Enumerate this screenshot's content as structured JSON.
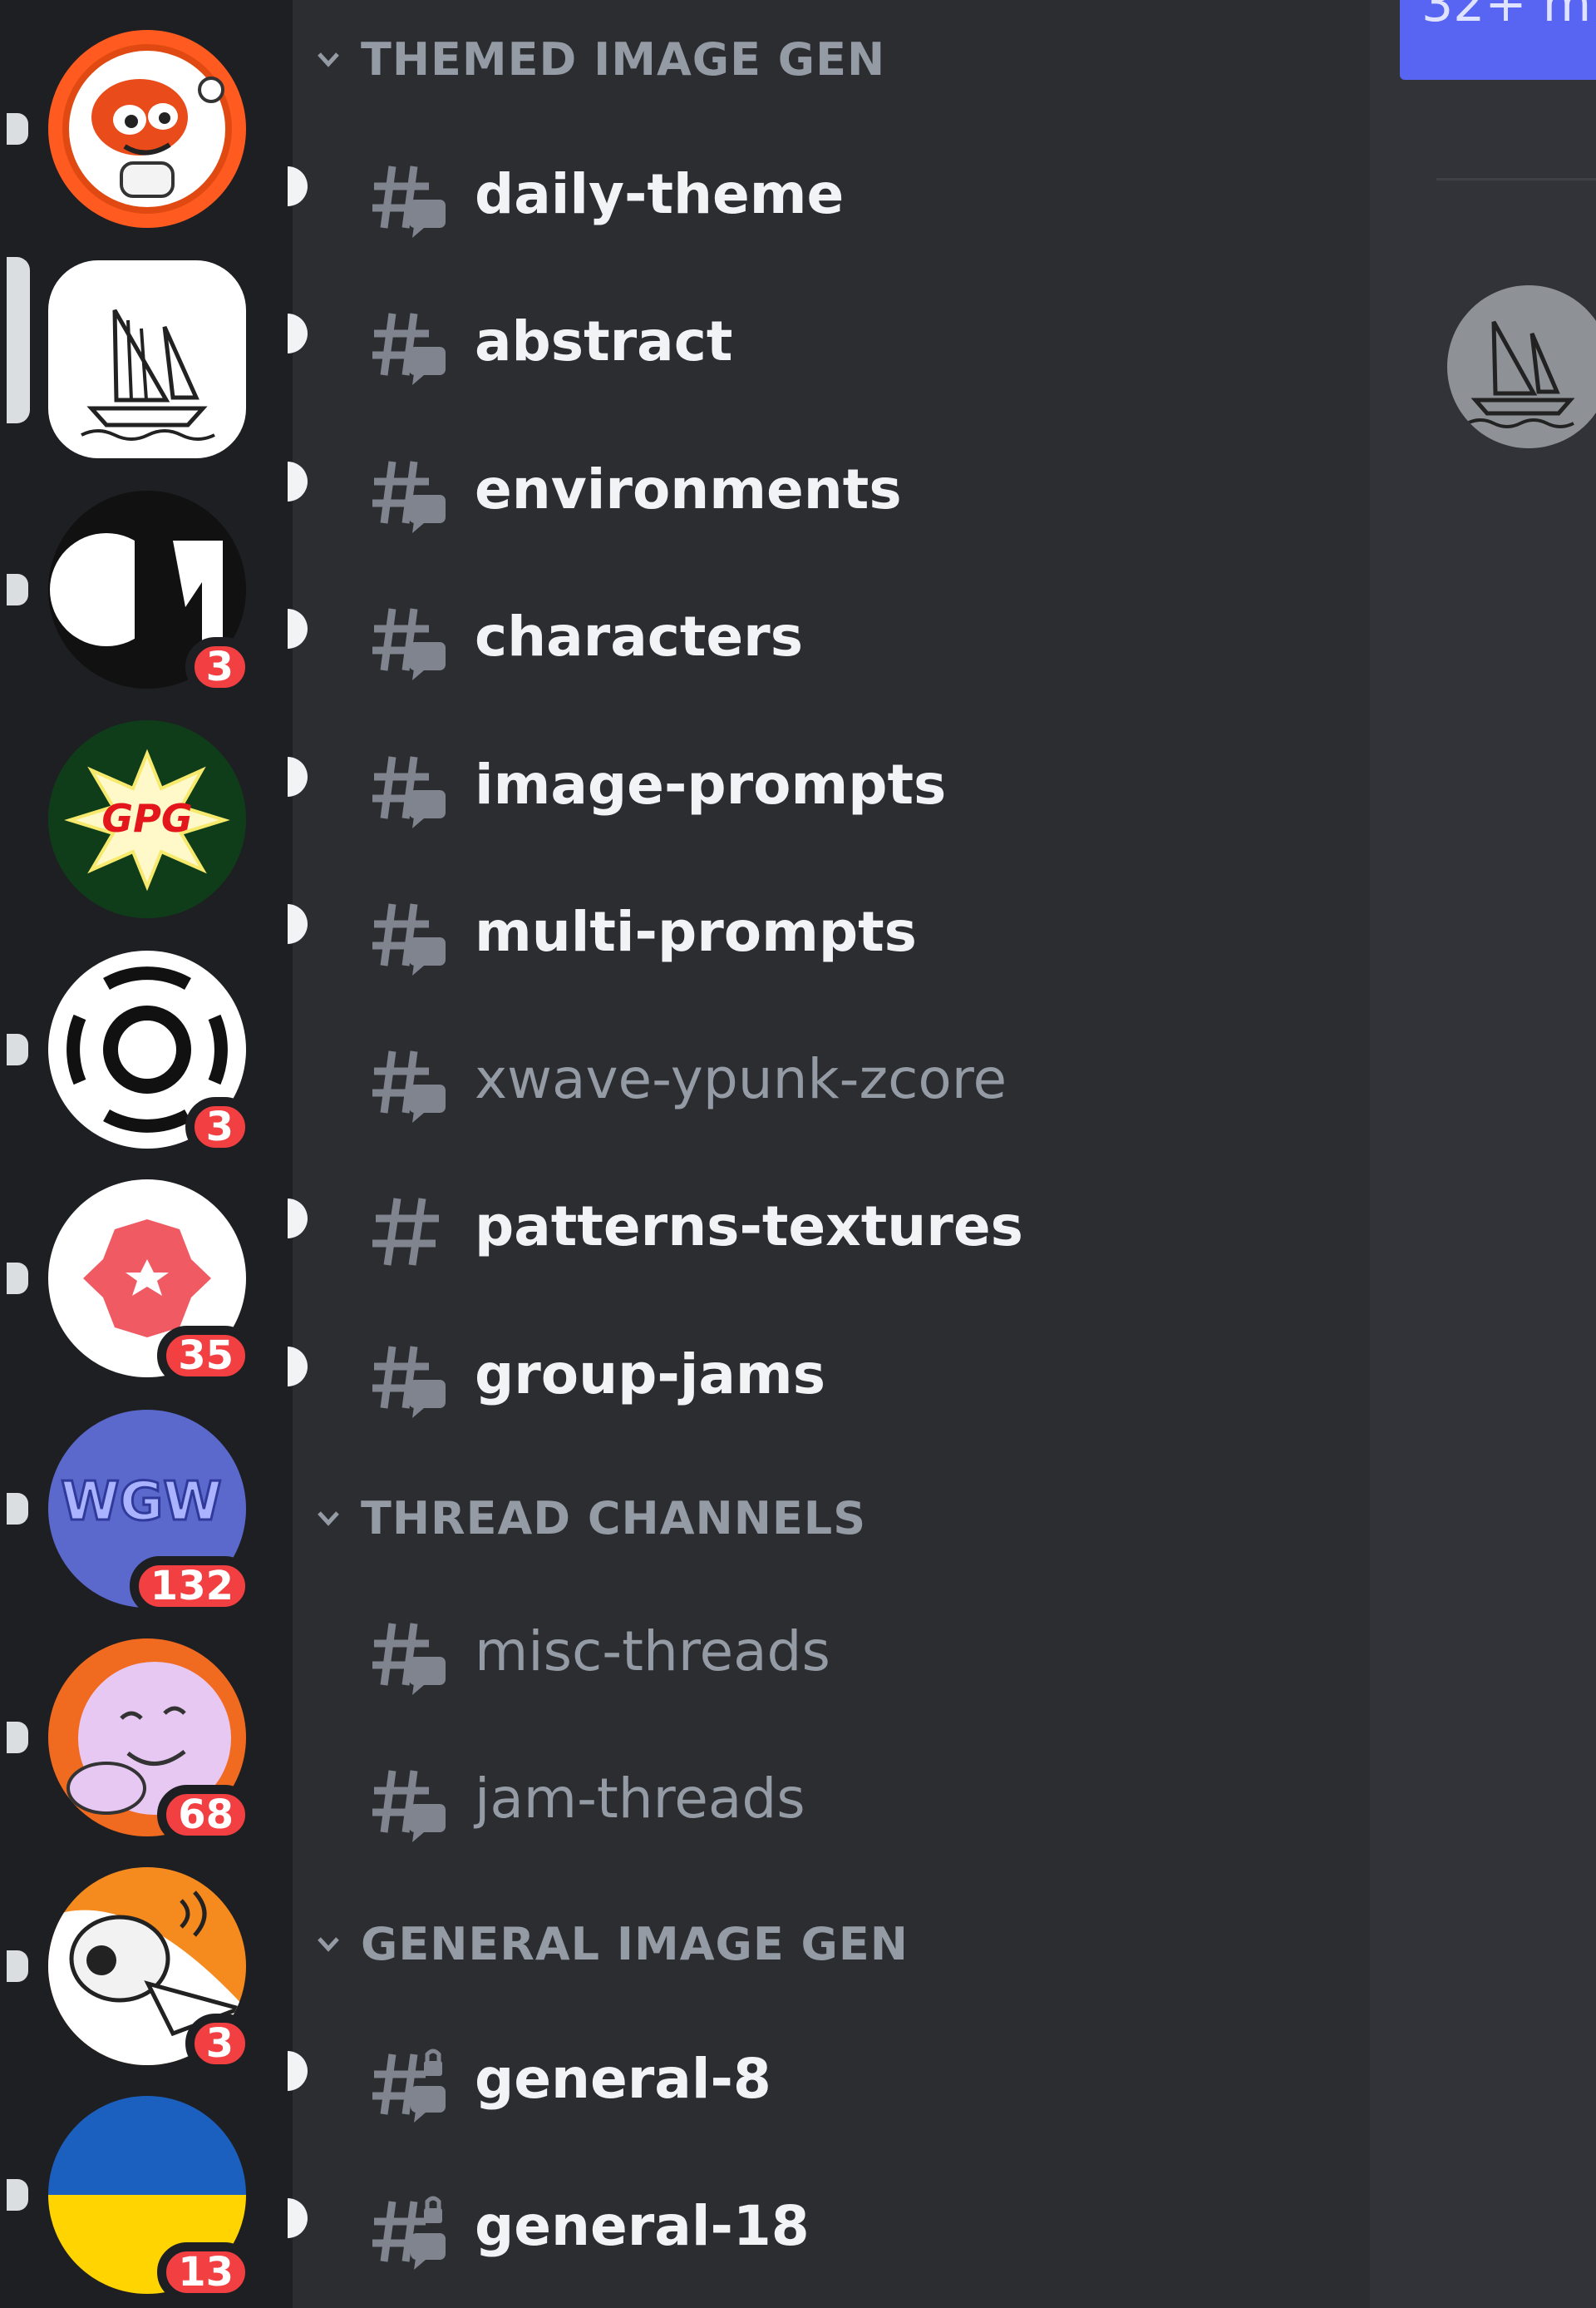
{
  "servers": [
    {
      "name": "reddit-server",
      "unread": true,
      "selected": false,
      "badge": ""
    },
    {
      "name": "midjourney-server",
      "unread": false,
      "selected": true,
      "badge": ""
    },
    {
      "name": "m-server",
      "unread": true,
      "selected": false,
      "badge": "3"
    },
    {
      "name": "gpg-server",
      "unread": false,
      "selected": false,
      "badge": ""
    },
    {
      "name": "ring-server",
      "unread": true,
      "selected": false,
      "badge": "3"
    },
    {
      "name": "hex-server",
      "unread": true,
      "selected": false,
      "badge": "35"
    },
    {
      "name": "wgw-server",
      "unread": true,
      "selected": false,
      "badge": "132"
    },
    {
      "name": "smile-server",
      "unread": true,
      "selected": false,
      "badge": "68"
    },
    {
      "name": "duck-server",
      "unread": true,
      "selected": false,
      "badge": "3"
    },
    {
      "name": "flag-server",
      "unread": true,
      "selected": false,
      "badge": "13"
    }
  ],
  "logo_text": {
    "gpg": "GPG",
    "wgw": "WGW"
  },
  "categories": [
    {
      "label": "THEMED IMAGE GEN"
    },
    {
      "label": "THREAD CHANNELS"
    },
    {
      "label": "GENERAL IMAGE GEN"
    }
  ],
  "channels": [
    {
      "name": "daily-theme",
      "unread": true,
      "icon": "forum-hash-icon"
    },
    {
      "name": "abstract",
      "unread": true,
      "icon": "forum-hash-icon"
    },
    {
      "name": "environments",
      "unread": true,
      "icon": "forum-hash-icon"
    },
    {
      "name": "characters",
      "unread": true,
      "icon": "forum-hash-icon"
    },
    {
      "name": "image-prompts",
      "unread": true,
      "icon": "forum-hash-icon"
    },
    {
      "name": "multi-prompts",
      "unread": true,
      "icon": "forum-hash-icon"
    },
    {
      "name": "xwave-ypunk-zcore",
      "unread": false,
      "icon": "forum-hash-icon"
    },
    {
      "name": "patterns-textures",
      "unread": true,
      "icon": "hash-icon"
    },
    {
      "name": "group-jams",
      "unread": true,
      "icon": "forum-hash-icon"
    },
    {
      "name": "misc-threads",
      "unread": false,
      "icon": "forum-hash-icon"
    },
    {
      "name": "jam-threads",
      "unread": false,
      "icon": "forum-hash-icon"
    },
    {
      "name": "general-8",
      "unread": true,
      "icon": "locked-forum-hash-icon"
    },
    {
      "name": "general-18",
      "unread": true,
      "icon": "locked-forum-hash-icon"
    }
  ],
  "right_panel": {
    "header_text": "32+ m"
  },
  "colors": {
    "accent": "#5865f2",
    "badge": "#f23f42",
    "rail": "#1e1f22",
    "sidebar": "#2b2d31",
    "content": "#313338"
  }
}
